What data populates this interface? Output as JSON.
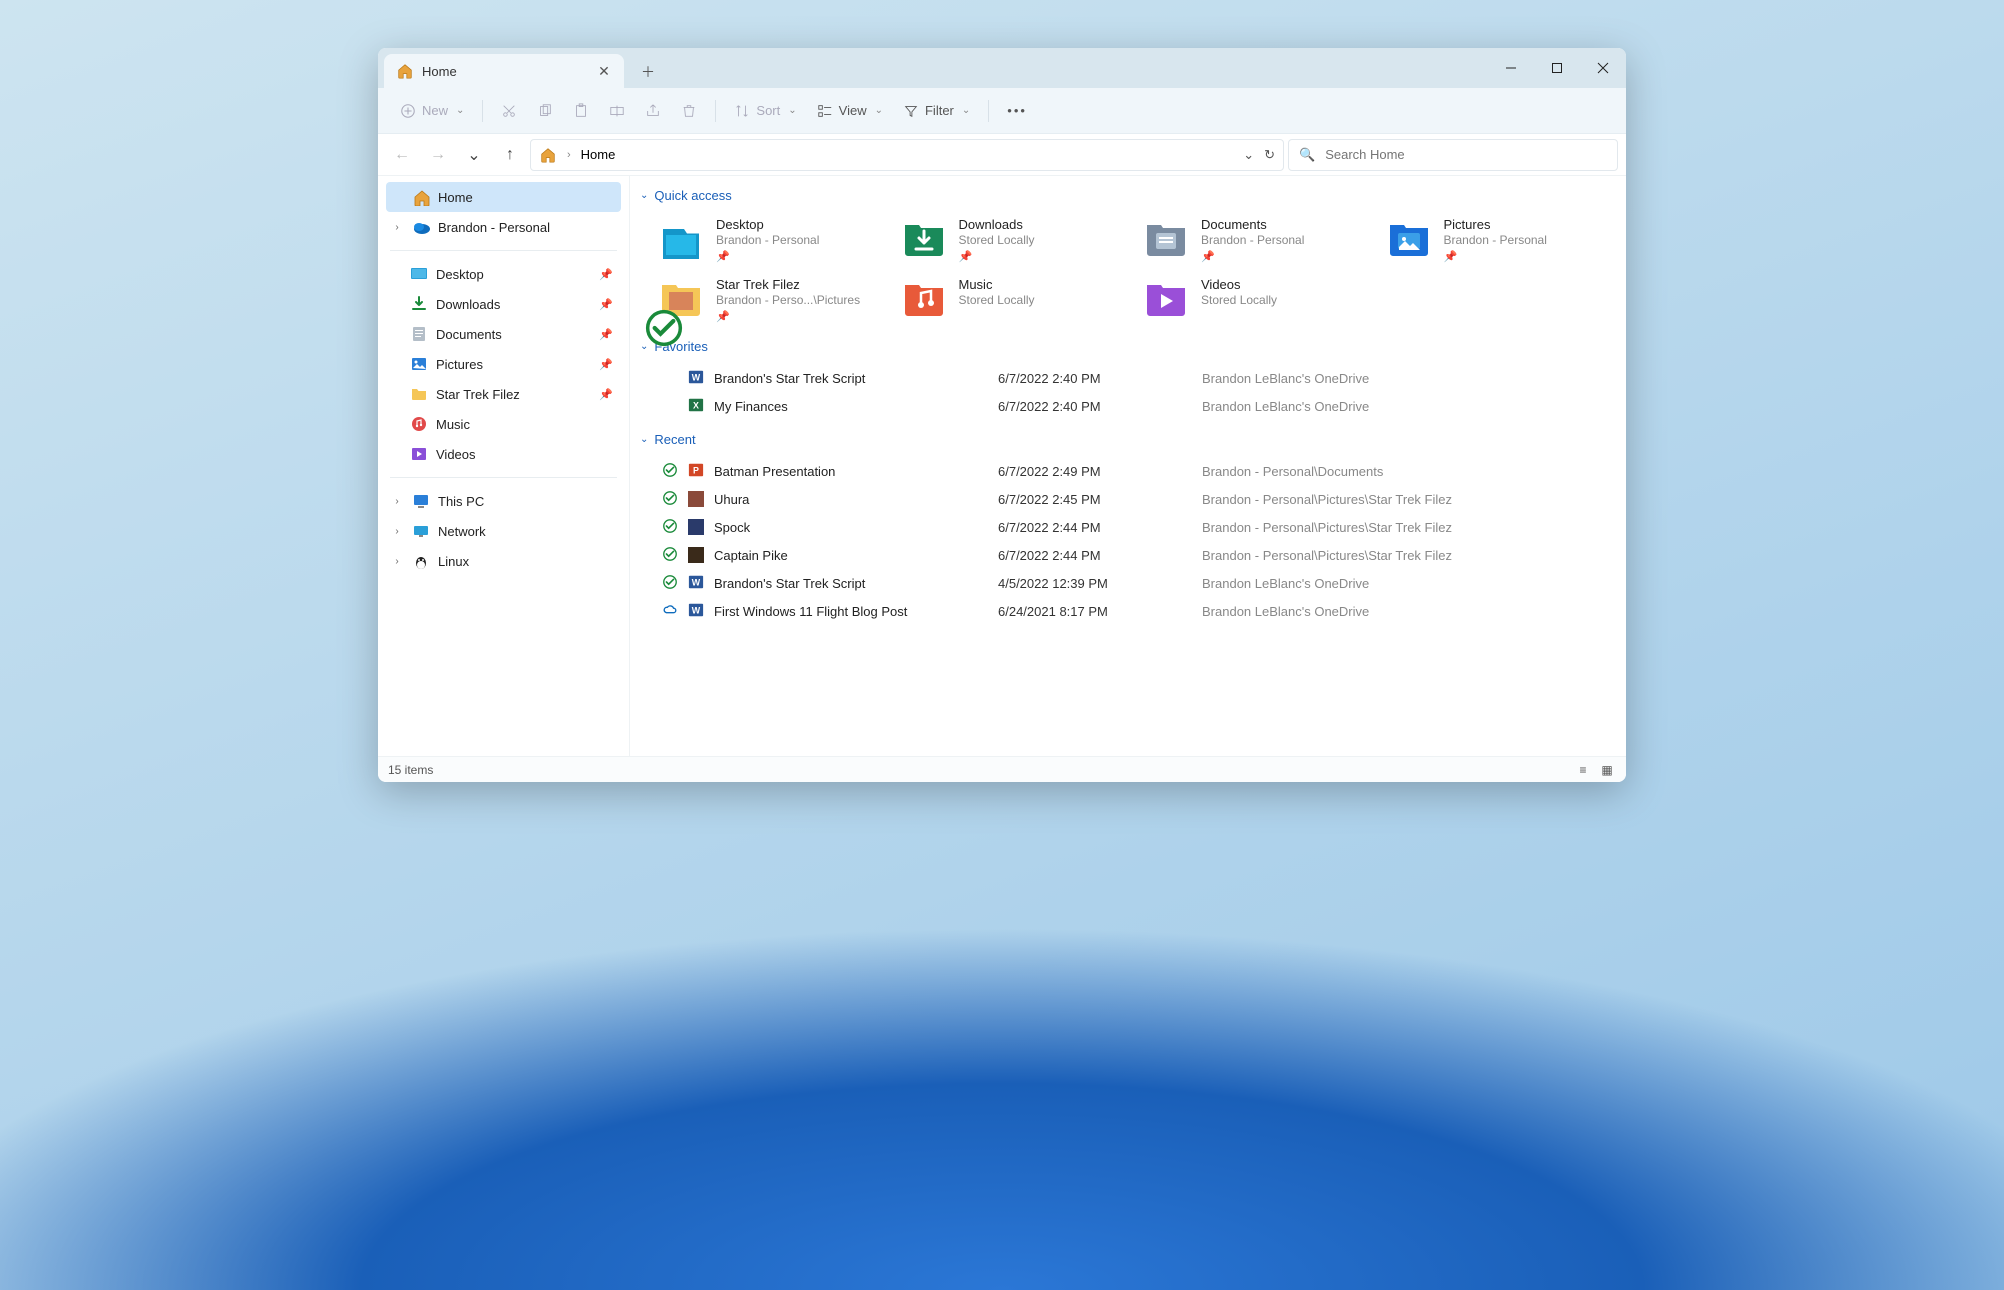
{
  "tab": {
    "title": "Home"
  },
  "toolbar": {
    "new_label": "New",
    "sort_label": "Sort",
    "view_label": "View",
    "filter_label": "Filter"
  },
  "breadcrumb": {
    "current": "Home"
  },
  "search": {
    "placeholder": "Search Home"
  },
  "sidebar": {
    "top": [
      {
        "label": "Home",
        "icon": "home",
        "active": true
      },
      {
        "label": "Brandon - Personal",
        "icon": "onedrive",
        "expandable": true
      }
    ],
    "pins": [
      {
        "label": "Desktop",
        "icon": "desktop",
        "pinned": true
      },
      {
        "label": "Downloads",
        "icon": "downloads",
        "pinned": true
      },
      {
        "label": "Documents",
        "icon": "documents",
        "pinned": true
      },
      {
        "label": "Pictures",
        "icon": "pictures",
        "pinned": true
      },
      {
        "label": "Star Trek Filez",
        "icon": "folder",
        "pinned": true
      },
      {
        "label": "Music",
        "icon": "music",
        "pinned": false
      },
      {
        "label": "Videos",
        "icon": "videos",
        "pinned": false
      }
    ],
    "bottom": [
      {
        "label": "This PC",
        "icon": "thispc",
        "expandable": true
      },
      {
        "label": "Network",
        "icon": "network",
        "expandable": true
      },
      {
        "label": "Linux",
        "icon": "linux",
        "expandable": true
      }
    ]
  },
  "sections": {
    "quick_access_label": "Quick access",
    "favorites_label": "Favorites",
    "recent_label": "Recent"
  },
  "quick_access": [
    {
      "name": "Desktop",
      "sub": "Brandon - Personal",
      "icon": "desktop-folder",
      "pinned": true
    },
    {
      "name": "Downloads",
      "sub": "Stored Locally",
      "icon": "downloads-folder",
      "pinned": true
    },
    {
      "name": "Documents",
      "sub": "Brandon - Personal",
      "icon": "documents-folder",
      "pinned": true
    },
    {
      "name": "Pictures",
      "sub": "Brandon - Personal",
      "icon": "pictures-folder",
      "pinned": true
    },
    {
      "name": "Star Trek Filez",
      "sub": "Brandon - Perso...\\Pictures",
      "icon": "photo-folder",
      "pinned": true,
      "synced": true
    },
    {
      "name": "Music",
      "sub": "Stored Locally",
      "icon": "music-folder",
      "pinned": false
    },
    {
      "name": "Videos",
      "sub": "Stored Locally",
      "icon": "videos-folder",
      "pinned": false
    }
  ],
  "favorites": [
    {
      "name": "Brandon's Star Trek Script",
      "date": "6/7/2022 2:40 PM",
      "location": "Brandon LeBlanc's OneDrive",
      "icon": "word"
    },
    {
      "name": "My Finances",
      "date": "6/7/2022 2:40 PM",
      "location": "Brandon LeBlanc's OneDrive",
      "icon": "excel"
    }
  ],
  "recent": [
    {
      "name": "Batman Presentation",
      "date": "6/7/2022 2:49 PM",
      "location": "Brandon - Personal\\Documents",
      "icon": "powerpoint",
      "status": "synced"
    },
    {
      "name": "Uhura",
      "date": "6/7/2022 2:45 PM",
      "location": "Brandon - Personal\\Pictures\\Star Trek Filez",
      "icon": "img1",
      "status": "synced"
    },
    {
      "name": "Spock",
      "date": "6/7/2022 2:44 PM",
      "location": "Brandon - Personal\\Pictures\\Star Trek Filez",
      "icon": "img2",
      "status": "synced"
    },
    {
      "name": "Captain Pike",
      "date": "6/7/2022 2:44 PM",
      "location": "Brandon - Personal\\Pictures\\Star Trek Filez",
      "icon": "img3",
      "status": "synced"
    },
    {
      "name": "Brandon's Star Trek Script",
      "date": "4/5/2022 12:39 PM",
      "location": "Brandon LeBlanc's OneDrive",
      "icon": "word",
      "status": "synced"
    },
    {
      "name": "First Windows 11 Flight Blog Post",
      "date": "6/24/2021 8:17 PM",
      "location": "Brandon LeBlanc's OneDrive",
      "icon": "word",
      "status": "cloud"
    }
  ],
  "status": {
    "item_count": "15 items"
  }
}
